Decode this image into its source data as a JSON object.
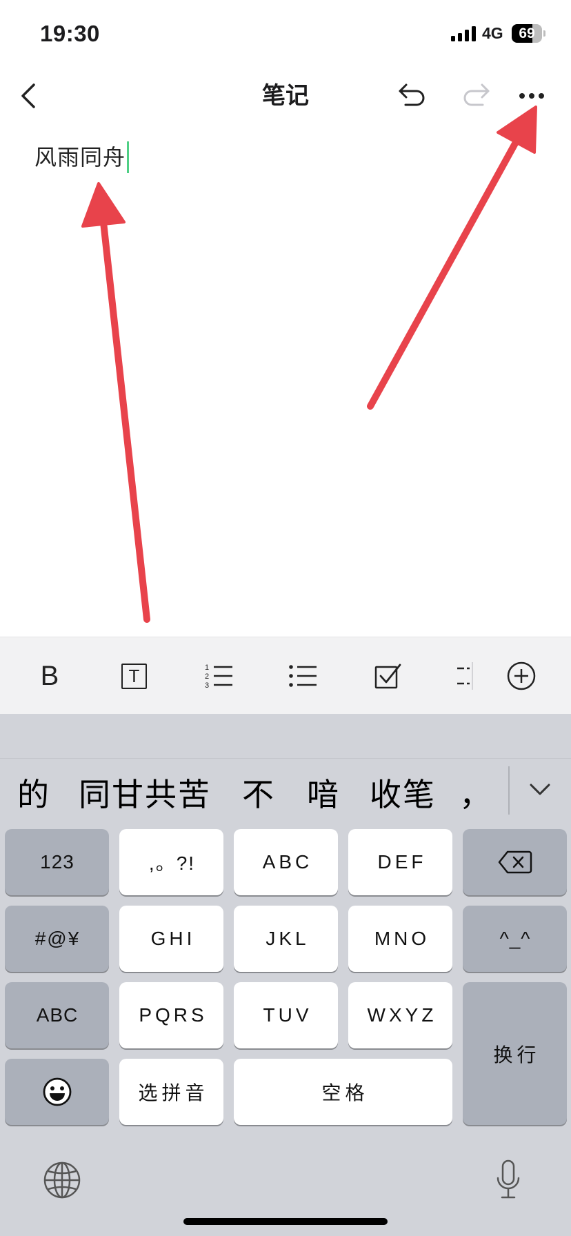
{
  "status_bar": {
    "time": "19:30",
    "network": "4G",
    "battery_level": "69"
  },
  "nav": {
    "title": "笔记",
    "icons": [
      "back-icon",
      "undo-icon",
      "redo-icon",
      "more-icon"
    ],
    "redo_enabled": false
  },
  "editor": {
    "content": "风雨同舟",
    "cursor_visible": true
  },
  "format_toolbar": {
    "bold_label": "B",
    "text_style_label": "T",
    "numbered_list_digits": [
      "1",
      "2",
      "3"
    ],
    "icons": [
      "bold-icon",
      "text-style-icon",
      "numbered-list-icon",
      "bullet-list-icon",
      "checklist-icon",
      "divider-icon",
      "insert-plus-icon"
    ]
  },
  "keyboard": {
    "candidates": [
      "的",
      "同甘共苦",
      "不",
      "喑",
      "收笔",
      "，"
    ],
    "keys": {
      "numbers": "123",
      "punctuation": ",。?!",
      "abc": "ABC",
      "def": "DEF",
      "symbols": "#@¥",
      "ghi": "GHI",
      "jkl": "JKL",
      "mno": "MNO",
      "emoticon": "^_^",
      "abc_switch": "ABC",
      "pqrs": "PQRS",
      "tuv": "TUV",
      "wxyz": "WXYZ",
      "return": "换行",
      "select_pinyin": "选拼音",
      "space": "空格"
    },
    "icons": [
      "backspace-icon",
      "emoji-icon",
      "collapse-chevron-icon",
      "globe-icon",
      "microphone-icon"
    ]
  },
  "colors": {
    "cursor": "#4fcf85",
    "annotation_arrow": "#e8434b",
    "keyboard_background": "#d1d3d9",
    "function_key": "#abb0ba",
    "letter_key": "#ffffff",
    "toolbar_background": "#f2f2f3",
    "disabled_icon": "#c7c7cc"
  }
}
